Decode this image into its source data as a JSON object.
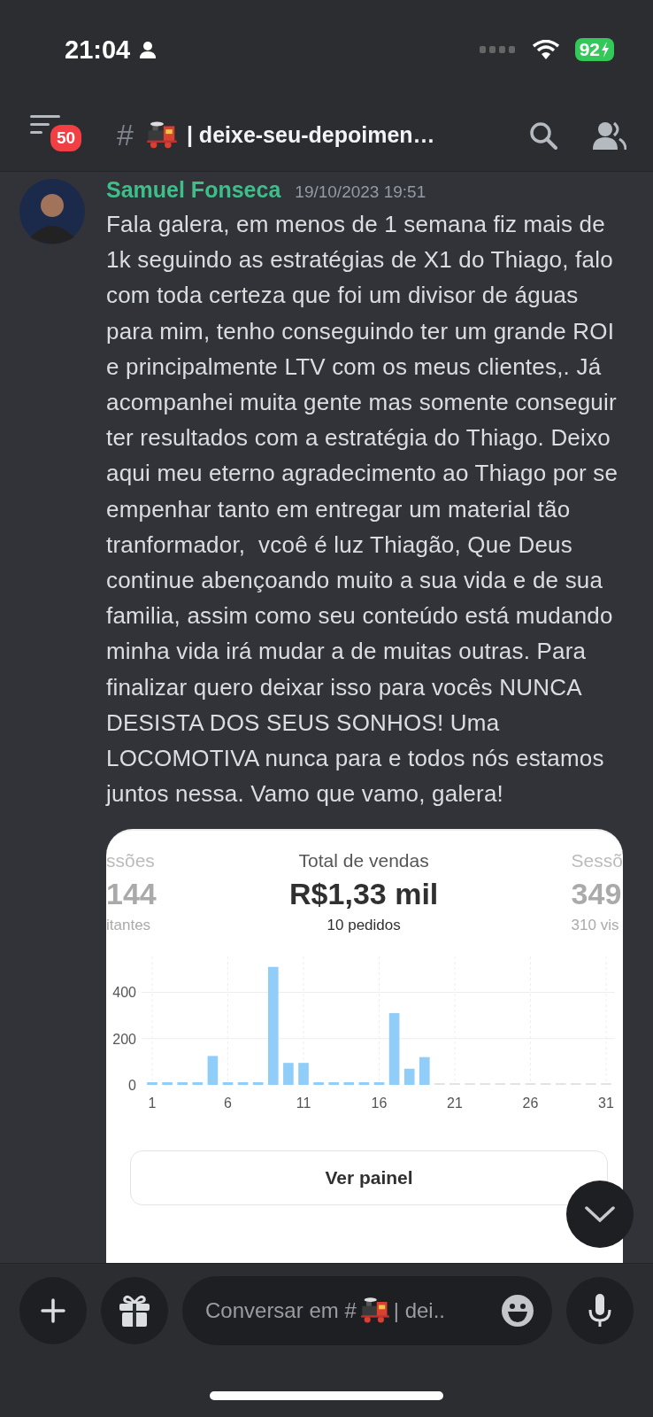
{
  "status_bar": {
    "time": "21:04",
    "battery": "92"
  },
  "header": {
    "badge": "50",
    "hash": "#",
    "title": "| deixe-seu-depoimen…"
  },
  "message": {
    "author": "Samuel Fonseca",
    "timestamp": "19/10/2023 19:51",
    "text": "Fala galera, em menos de 1 semana fiz mais de 1k seguindo as estratégias de X1 do Thiago, falo com toda certeza que foi um divisor de águas para mim, tenho conseguindo ter um grande ROI e principalmente LTV com os meus clientes,. Já acompanhei muita gente mas somente conseguir ter resultados com a estratégia do Thiago. Deixo aqui meu eterno agradecimento ao Thiago por se empenhar tanto em entregar um material tão tranformador,  vcoê é luz Thiagão, Que Deus continue abençoando muito a sua vida e de sua familia, assim como seu conteúdo está mudando minha vida irá mudar a de muitas outras. Para finalizar quero deixar isso para vocês NUNCA DESISTA DOS SEUS SONHOS! Uma LOCOMOTIVA nunca para e todos nós estamos juntos nessa. Vamo que vamo, galera!",
    "attachment": {
      "stats": [
        {
          "selected": false,
          "label": "ssões",
          "value": "144",
          "sub": "itantes"
        },
        {
          "selected": true,
          "label": "Total de vendas",
          "value": "R$1,33 mil",
          "sub": "10 pedidos"
        },
        {
          "selected": false,
          "label": "Sessõ",
          "value": "349",
          "sub": "310 vis"
        }
      ],
      "chart_data": {
        "type": "bar",
        "x": [
          1,
          2,
          3,
          4,
          5,
          6,
          7,
          8,
          9,
          10,
          11,
          12,
          13,
          14,
          15,
          16,
          17,
          18,
          19
        ],
        "values": [
          0,
          0,
          0,
          0,
          125,
          0,
          0,
          0,
          510,
          95,
          95,
          0,
          0,
          0,
          0,
          0,
          310,
          70,
          120
        ],
        "xlim": [
          1,
          31
        ],
        "grid": true,
        "ylim": [
          0,
          555
        ],
        "xticks": [
          1,
          6,
          11,
          16,
          21,
          26,
          31
        ],
        "yticks": [
          0,
          200,
          400
        ]
      },
      "button": "Ver painel"
    }
  },
  "composer": {
    "placeholder_start": "Conversar em #",
    "placeholder_end": "| dei.."
  }
}
